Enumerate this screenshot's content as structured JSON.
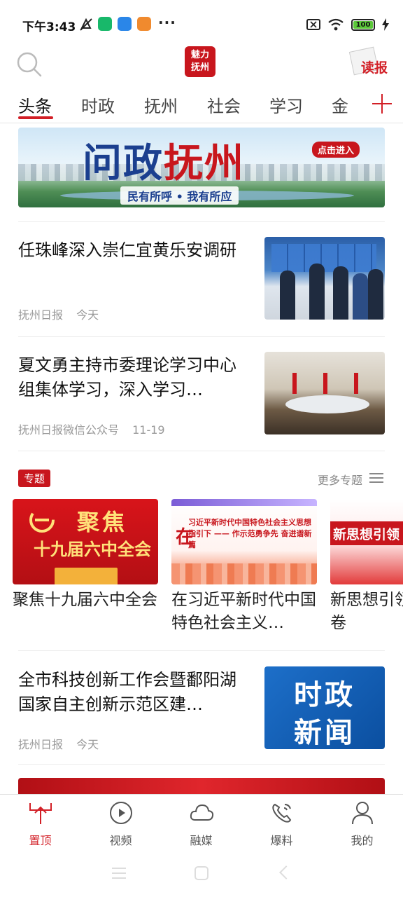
{
  "status_bar": {
    "time": "下午3:43",
    "battery": "100",
    "more": "···"
  },
  "header": {
    "logo_lines": [
      "魅力",
      "抚州"
    ],
    "paper_label": "读报"
  },
  "tabs": [
    {
      "label": "头条",
      "active": true
    },
    {
      "label": "时政"
    },
    {
      "label": "抚州"
    },
    {
      "label": "社会"
    },
    {
      "label": "学习"
    },
    {
      "label": "金"
    }
  ],
  "banner": {
    "title_a": "问政",
    "title_b": "抚州",
    "button": "点击进入",
    "subtitle": "民有所呼 • 我有所应"
  },
  "news": [
    {
      "title": "任珠峰深入崇仁宜黄乐安调研",
      "source": "抚州日报",
      "time": "今天"
    },
    {
      "title": "夏文勇主持市委理论学习中心组集体学习，深入学习…",
      "source": "抚州日报微信公众号",
      "time": "11-19"
    }
  ],
  "topics": {
    "badge": "专题",
    "more": "更多专题",
    "items": [
      {
        "title": "聚焦十九届六中全会",
        "img_big": "聚焦",
        "img_small": "十九届六中全会"
      },
      {
        "title": "在习近平新时代中国特色社会主义…",
        "img_caption": "习近平新时代中国特色社会主义思想",
        "img_caption2": "指引下 —— 作示范勇争先 奋进谱新篇",
        "img_zai": "在"
      },
      {
        "title": "新思想引领·时代答卷",
        "img_text": "新思想引领 时"
      }
    ]
  },
  "news_bottom": {
    "title": "全市科技创新工作会暨鄱阳湖国家自主创新示范区建…",
    "source": "抚州日报",
    "time": "今天",
    "thumb_lines": [
      "时政",
      "新闻"
    ]
  },
  "bottom_nav": [
    {
      "label": "置顶",
      "icon": "pin-top-icon",
      "active": true
    },
    {
      "label": "视频",
      "icon": "video-play-icon"
    },
    {
      "label": "融媒",
      "icon": "cloud-icon"
    },
    {
      "label": "爆料",
      "icon": "phone-report-icon"
    },
    {
      "label": "我的",
      "icon": "profile-icon"
    }
  ],
  "colors": {
    "accent": "#d21f26",
    "brand_blue": "#1b3f8f"
  }
}
